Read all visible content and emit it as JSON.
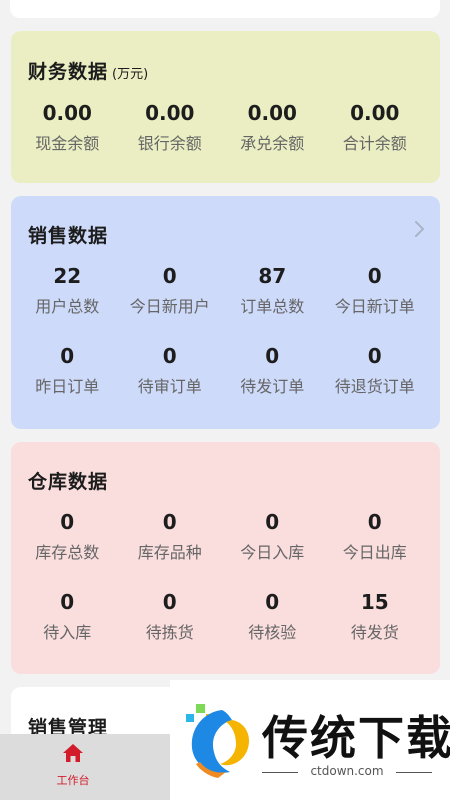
{
  "finance": {
    "title": "财务数据",
    "unit": "(万元)",
    "items": [
      {
        "value": "0.00",
        "label": "现金余额"
      },
      {
        "value": "0.00",
        "label": "银行余额"
      },
      {
        "value": "0.00",
        "label": "承兑余额"
      },
      {
        "value": "0.00",
        "label": "合计余额"
      }
    ]
  },
  "sales": {
    "title": "销售数据",
    "items": [
      {
        "value": "22",
        "label": "用户总数"
      },
      {
        "value": "0",
        "label": "今日新用户"
      },
      {
        "value": "87",
        "label": "订单总数"
      },
      {
        "value": "0",
        "label": "今日新订单"
      },
      {
        "value": "0",
        "label": "昨日订单"
      },
      {
        "value": "0",
        "label": "待审订单"
      },
      {
        "value": "0",
        "label": "待发订单"
      },
      {
        "value": "0",
        "label": "待退货订单"
      }
    ]
  },
  "warehouse": {
    "title": "仓库数据",
    "items": [
      {
        "value": "0",
        "label": "库存总数"
      },
      {
        "value": "0",
        "label": "库存品种"
      },
      {
        "value": "0",
        "label": "今日入库"
      },
      {
        "value": "0",
        "label": "今日出库"
      },
      {
        "value": "0",
        "label": "待入库"
      },
      {
        "value": "0",
        "label": "待拣货"
      },
      {
        "value": "0",
        "label": "待核验"
      },
      {
        "value": "15",
        "label": "待发货"
      }
    ]
  },
  "manage": {
    "title": "销售管理"
  },
  "tabbar": {
    "home_label": "工作台"
  },
  "watermark": {
    "brand": "传统下载",
    "url": "ctdown.com"
  },
  "colors": {
    "finance_bg": "#ebeec2",
    "sales_bg": "#cddafa",
    "warehouse_bg": "#fadddd",
    "accent_red": "#d21c2c"
  },
  "icons": {
    "more": "chevron-right-icon",
    "home": "home-icon",
    "logo": "brand-logo-icon"
  }
}
